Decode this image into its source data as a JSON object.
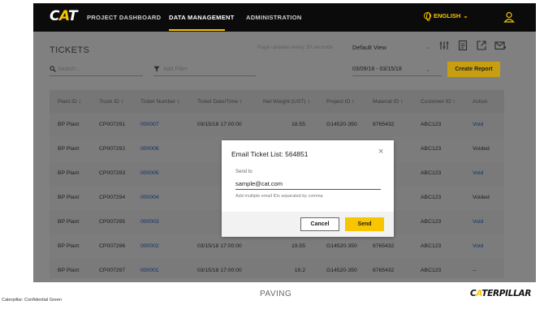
{
  "nav": {
    "logo_pre": "C",
    "logo_a": "A",
    "logo_post": "T",
    "items": [
      "PROJECT DASHBOARD",
      "DATA MANAGEMENT",
      "ADMINISTRATION"
    ],
    "active_index": 1,
    "language": "ENGLISH"
  },
  "page": {
    "title": "TICKETS",
    "update_note": "Page updates every 30 seconds",
    "view_select": "Default View",
    "search_placeholder": "Search...",
    "filter_placeholder": "Add Filter",
    "date_range": "03/09/18 - 03/15/18",
    "create_report_label": "Create Report"
  },
  "table": {
    "headers": [
      "Plant ID ↕",
      "Truck ID ↕",
      "Ticket Number ↕",
      "Ticket Date/Time ↕",
      "Net Weight (UST) ↕",
      "Project ID ↕",
      "Material ID ↕",
      "Customer ID ↕",
      "Action"
    ],
    "rows": [
      [
        "BP Plant",
        "CP007291",
        "000007",
        "03/15/18 17:00:00",
        "18.55",
        "G14520-350",
        "8765432",
        "ABC123",
        "Void"
      ],
      [
        "BP Plant",
        "CP007292",
        "000006",
        "",
        "",
        "",
        "8765432",
        "ABC123",
        "Voided"
      ],
      [
        "BP Plant",
        "CP007293",
        "000005",
        "",
        "",
        "",
        "8765432",
        "ABC123",
        "Void"
      ],
      [
        "BP Plant",
        "CP007294",
        "000004",
        "",
        "",
        "",
        "8765432",
        "ABC123",
        "Voided"
      ],
      [
        "BP Plant",
        "CP007295",
        "000003",
        "",
        "",
        "",
        "8765432",
        "ABC123",
        "Void"
      ],
      [
        "BP Plant",
        "CP007296",
        "000002",
        "03/15/18 17:00:00",
        "19.55",
        "G14520-350",
        "8765432",
        "ABC123",
        "Void"
      ],
      [
        "BP Plant",
        "CP007297",
        "000001",
        "03/15/18 17:00:00",
        "19.2",
        "G14520-350",
        "8765432",
        "ABC123",
        "--"
      ]
    ]
  },
  "modal": {
    "title": "Email Ticket List: 564851",
    "close_glyph": "×",
    "send_to_label": "Send to",
    "email_value": "sample@cat.com",
    "hint": "Add multiple email IDs separated by comma",
    "cancel_label": "Cancel",
    "send_label": "Send"
  },
  "slide": {
    "confidential": "Caterpillar: Confidential Green",
    "paving": "PAVING",
    "brand_pre": "C",
    "brand_a": "A",
    "brand_post": "TERPILLAR"
  },
  "colors": {
    "accent_yellow": "#f7c600",
    "nav_black": "#0b0b0b",
    "overlay_gray": "#808080",
    "link_blue": "#10316b"
  }
}
